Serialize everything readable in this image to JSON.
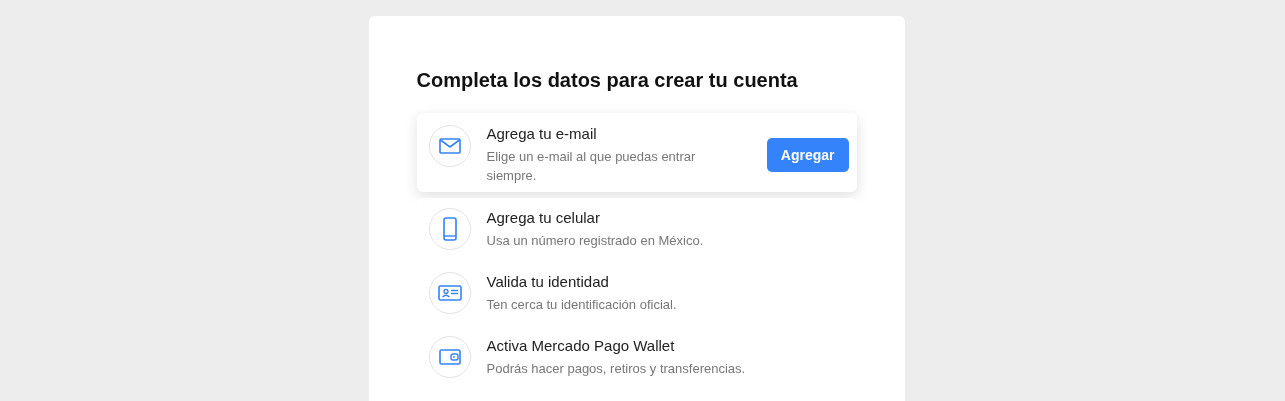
{
  "title": "Completa los datos para crear tu cuenta",
  "steps": [
    {
      "kind": "email",
      "title": "Agrega tu e-mail",
      "description": "Elige un e-mail al que puedas entrar siempre.",
      "active": true,
      "button": "Agregar"
    },
    {
      "kind": "phone",
      "title": "Agrega tu celular",
      "description": "Usa un número registrado en México.",
      "active": false
    },
    {
      "kind": "id",
      "title": "Valida tu identidad",
      "description": "Ten cerca tu identificación oficial.",
      "active": false
    },
    {
      "kind": "wallet",
      "title": "Activa Mercado Pago Wallet",
      "description": "Podrás hacer pagos, retiros y transferencias.",
      "active": false
    }
  ]
}
